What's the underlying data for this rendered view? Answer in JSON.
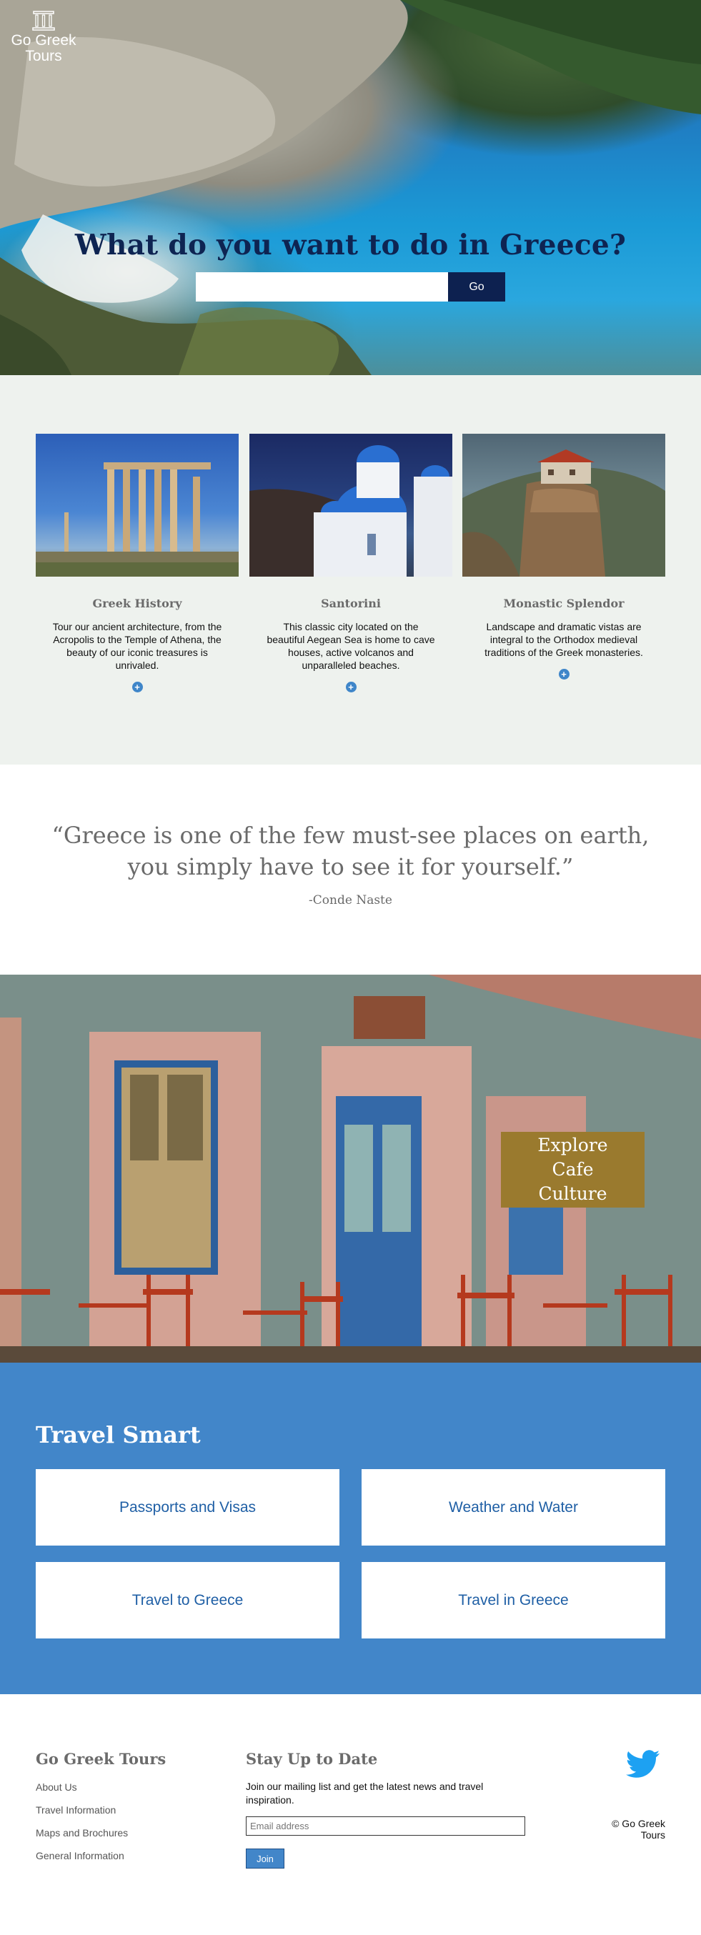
{
  "brand": {
    "logo_line1": "Go Greek",
    "logo_line2": "Tours"
  },
  "hero": {
    "title": "What do you want to do in Greece?",
    "search_placeholder": "",
    "go_label": "Go"
  },
  "features": [
    {
      "title": "Greek History",
      "description": "Tour our ancient architecture, from the Acropolis to the Temple of Athena, the beauty of our iconic treasures is unrivaled."
    },
    {
      "title": "Santorini",
      "description": "This classic city located on the beautiful Aegean Sea is home to cave houses, active volcanos and unparalleled beaches."
    },
    {
      "title": "Monastic Splendor",
      "description": "Landscape and dramatic vistas are integral to the Orthodox medieval traditions of the Greek monasteries."
    }
  ],
  "quote": {
    "text": "“Greece is one of the few must-see places on earth, you simply have to see it for yourself.”",
    "attribution": "-Conde Naste"
  },
  "cafe": {
    "button_label": "Explore Cafe Culture"
  },
  "travel_smart": {
    "title": "Travel Smart",
    "tiles": [
      "Passports and Visas",
      "Weather and Water",
      "Travel to Greece",
      "Travel in Greece"
    ]
  },
  "footer": {
    "brand_heading": "Go Greek Tours",
    "links": [
      "About Us",
      "Travel Information",
      "Maps and Brochures",
      "General Information"
    ],
    "newsletter_heading": "Stay Up to Date",
    "newsletter_text": "Join our mailing list and get the latest news and travel inspiration.",
    "email_placeholder": "Email address",
    "join_label": "Join",
    "copyright": "© Go Greek Tours"
  },
  "colors": {
    "navy": "#0d2150",
    "blue": "#4286c9",
    "gold": "#9a7a2e",
    "light_bg": "#eef2ee",
    "twitter": "#1da1f2"
  },
  "icons": [
    "column-icon",
    "plus-circle-icon",
    "twitter-icon"
  ]
}
